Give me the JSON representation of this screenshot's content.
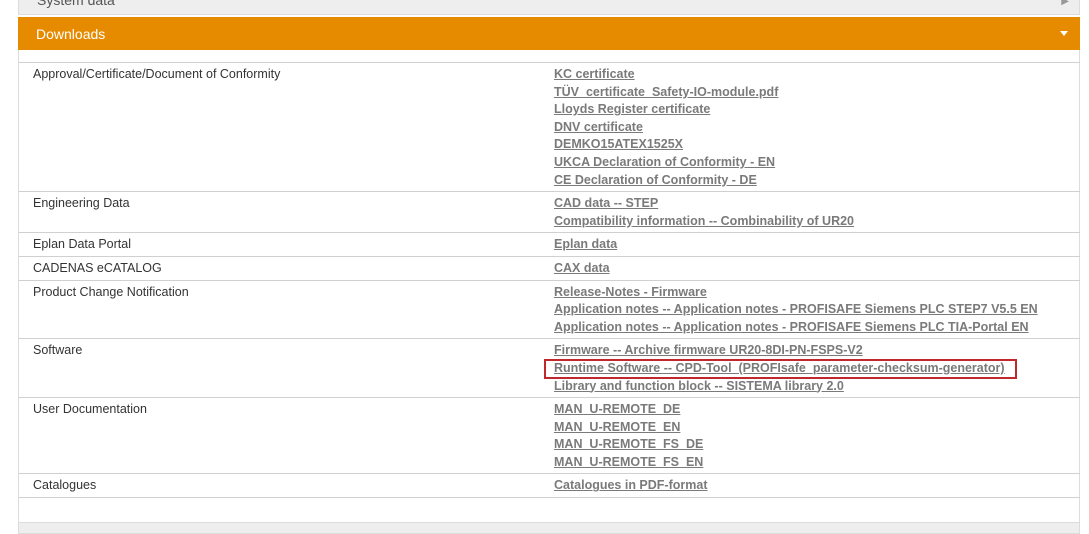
{
  "top_section": {
    "label": "System data"
  },
  "downloads": {
    "title": "Downloads",
    "rows": [
      {
        "label": "Approval/Certificate/Document of Conformity",
        "links": [
          "KC certificate",
          "TÜV_certificate_Safety-IO-module.pdf",
          "Lloyds Register certificate",
          "DNV certificate",
          "DEMKO15ATEX1525X",
          "UKCA Declaration of Conformity - EN",
          "CE Declaration of Conformity - DE"
        ]
      },
      {
        "label": "Engineering Data",
        "links": [
          "CAD data -- STEP",
          "Compatibility information -- Combinability of UR20"
        ]
      },
      {
        "label": "Eplan Data Portal",
        "links": [
          "Eplan data"
        ]
      },
      {
        "label": "CADENAS eCATALOG",
        "links": [
          "CAX data"
        ]
      },
      {
        "label": "Product Change Notification",
        "links": [
          "Release-Notes - Firmware",
          "Application notes -- Application notes - PROFISAFE Siemens PLC STEP7 V5.5 EN",
          "Application notes -- Application notes - PROFISAFE Siemens PLC TIA-Portal EN"
        ]
      },
      {
        "label": "Software",
        "links": [
          "Firmware -- Archive firmware UR20-8DI-PN-FSPS-V2",
          "Runtime Software -- CPD-Tool_(PROFIsafe_parameter-checksum-generator)",
          "Library and function block -- SISTEMA library 2.0"
        ]
      },
      {
        "label": "User Documentation",
        "links": [
          "MAN_U-REMOTE_DE",
          "MAN_U-REMOTE_EN",
          "MAN_U-REMOTE_FS_DE",
          "MAN_U-REMOTE_FS_EN"
        ]
      },
      {
        "label": "Catalogues",
        "links": [
          "Catalogues in PDF-format"
        ]
      }
    ]
  },
  "colors": {
    "accent": "#e68a00",
    "link": "#7a7a7a",
    "highlight_border": "#c0282d"
  }
}
